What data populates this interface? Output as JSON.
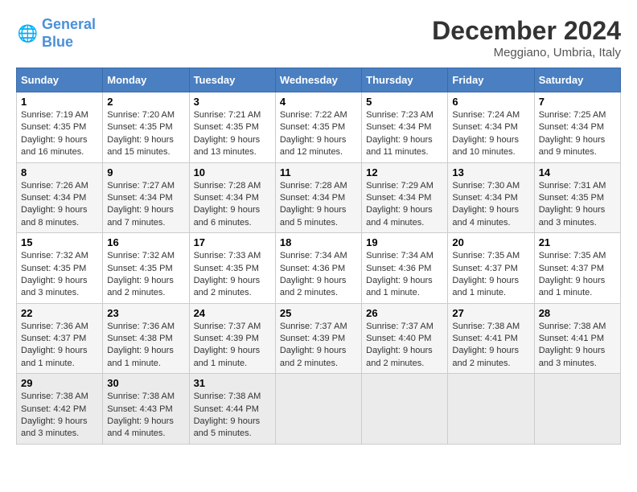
{
  "header": {
    "logo_line1": "General",
    "logo_line2": "Blue",
    "month": "December 2024",
    "location": "Meggiano, Umbria, Italy"
  },
  "days_of_week": [
    "Sunday",
    "Monday",
    "Tuesday",
    "Wednesday",
    "Thursday",
    "Friday",
    "Saturday"
  ],
  "weeks": [
    [
      {
        "day": 1,
        "sunrise": "7:19 AM",
        "sunset": "4:35 PM",
        "daylight": "9 hours and 16 minutes."
      },
      {
        "day": 2,
        "sunrise": "7:20 AM",
        "sunset": "4:35 PM",
        "daylight": "9 hours and 15 minutes."
      },
      {
        "day": 3,
        "sunrise": "7:21 AM",
        "sunset": "4:35 PM",
        "daylight": "9 hours and 13 minutes."
      },
      {
        "day": 4,
        "sunrise": "7:22 AM",
        "sunset": "4:35 PM",
        "daylight": "9 hours and 12 minutes."
      },
      {
        "day": 5,
        "sunrise": "7:23 AM",
        "sunset": "4:34 PM",
        "daylight": "9 hours and 11 minutes."
      },
      {
        "day": 6,
        "sunrise": "7:24 AM",
        "sunset": "4:34 PM",
        "daylight": "9 hours and 10 minutes."
      },
      {
        "day": 7,
        "sunrise": "7:25 AM",
        "sunset": "4:34 PM",
        "daylight": "9 hours and 9 minutes."
      }
    ],
    [
      {
        "day": 8,
        "sunrise": "7:26 AM",
        "sunset": "4:34 PM",
        "daylight": "9 hours and 8 minutes."
      },
      {
        "day": 9,
        "sunrise": "7:27 AM",
        "sunset": "4:34 PM",
        "daylight": "9 hours and 7 minutes."
      },
      {
        "day": 10,
        "sunrise": "7:28 AM",
        "sunset": "4:34 PM",
        "daylight": "9 hours and 6 minutes."
      },
      {
        "day": 11,
        "sunrise": "7:28 AM",
        "sunset": "4:34 PM",
        "daylight": "9 hours and 5 minutes."
      },
      {
        "day": 12,
        "sunrise": "7:29 AM",
        "sunset": "4:34 PM",
        "daylight": "9 hours and 4 minutes."
      },
      {
        "day": 13,
        "sunrise": "7:30 AM",
        "sunset": "4:34 PM",
        "daylight": "9 hours and 4 minutes."
      },
      {
        "day": 14,
        "sunrise": "7:31 AM",
        "sunset": "4:35 PM",
        "daylight": "9 hours and 3 minutes."
      }
    ],
    [
      {
        "day": 15,
        "sunrise": "7:32 AM",
        "sunset": "4:35 PM",
        "daylight": "9 hours and 3 minutes."
      },
      {
        "day": 16,
        "sunrise": "7:32 AM",
        "sunset": "4:35 PM",
        "daylight": "9 hours and 2 minutes."
      },
      {
        "day": 17,
        "sunrise": "7:33 AM",
        "sunset": "4:35 PM",
        "daylight": "9 hours and 2 minutes."
      },
      {
        "day": 18,
        "sunrise": "7:34 AM",
        "sunset": "4:36 PM",
        "daylight": "9 hours and 2 minutes."
      },
      {
        "day": 19,
        "sunrise": "7:34 AM",
        "sunset": "4:36 PM",
        "daylight": "9 hours and 1 minute."
      },
      {
        "day": 20,
        "sunrise": "7:35 AM",
        "sunset": "4:37 PM",
        "daylight": "9 hours and 1 minute."
      },
      {
        "day": 21,
        "sunrise": "7:35 AM",
        "sunset": "4:37 PM",
        "daylight": "9 hours and 1 minute."
      }
    ],
    [
      {
        "day": 22,
        "sunrise": "7:36 AM",
        "sunset": "4:37 PM",
        "daylight": "9 hours and 1 minute."
      },
      {
        "day": 23,
        "sunrise": "7:36 AM",
        "sunset": "4:38 PM",
        "daylight": "9 hours and 1 minute."
      },
      {
        "day": 24,
        "sunrise": "7:37 AM",
        "sunset": "4:39 PM",
        "daylight": "9 hours and 1 minute."
      },
      {
        "day": 25,
        "sunrise": "7:37 AM",
        "sunset": "4:39 PM",
        "daylight": "9 hours and 2 minutes."
      },
      {
        "day": 26,
        "sunrise": "7:37 AM",
        "sunset": "4:40 PM",
        "daylight": "9 hours and 2 minutes."
      },
      {
        "day": 27,
        "sunrise": "7:38 AM",
        "sunset": "4:41 PM",
        "daylight": "9 hours and 2 minutes."
      },
      {
        "day": 28,
        "sunrise": "7:38 AM",
        "sunset": "4:41 PM",
        "daylight": "9 hours and 3 minutes."
      }
    ],
    [
      {
        "day": 29,
        "sunrise": "7:38 AM",
        "sunset": "4:42 PM",
        "daylight": "9 hours and 3 minutes."
      },
      {
        "day": 30,
        "sunrise": "7:38 AM",
        "sunset": "4:43 PM",
        "daylight": "9 hours and 4 minutes."
      },
      {
        "day": 31,
        "sunrise": "7:38 AM",
        "sunset": "4:44 PM",
        "daylight": "9 hours and 5 minutes."
      },
      null,
      null,
      null,
      null
    ]
  ]
}
